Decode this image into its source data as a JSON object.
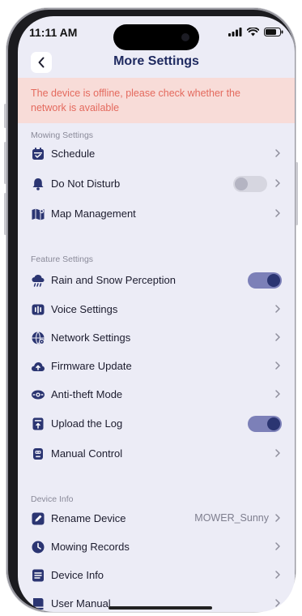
{
  "status_bar": {
    "time": "11:11 AM"
  },
  "header": {
    "title": "More Settings"
  },
  "banner": {
    "text": "The device is offline, please check whether the network is available"
  },
  "colors": {
    "accent": "#2b3572",
    "warning_text": "#e46a5e",
    "warning_bg": "#f8dcd8",
    "screen_bg": "#ececf6"
  },
  "mowing_settings": {
    "label": "Mowing Settings",
    "items": [
      {
        "label": "Schedule",
        "icon": "calendar-icon"
      },
      {
        "label": "Do Not Disturb",
        "icon": "bell-icon",
        "toggle": false
      },
      {
        "label": "Map Management",
        "icon": "map-icon"
      }
    ]
  },
  "feature_settings": {
    "label": "Feature Settings",
    "items": [
      {
        "label": "Rain and Snow Perception",
        "icon": "rain-cloud-icon",
        "toggle": true
      },
      {
        "label": "Voice Settings",
        "icon": "voice-icon"
      },
      {
        "label": "Network Settings",
        "icon": "network-gear-icon"
      },
      {
        "label": "Firmware Update",
        "icon": "cloud-upload-icon"
      },
      {
        "label": "Anti-theft Mode",
        "icon": "anti-theft-icon"
      },
      {
        "label": "Upload the Log",
        "icon": "log-upload-icon",
        "toggle": true
      },
      {
        "label": "Manual Control",
        "icon": "robot-icon"
      }
    ]
  },
  "device_info": {
    "label": "Device Info",
    "items": [
      {
        "label": "Rename Device",
        "icon": "edit-icon",
        "value": "MOWER_Sunny"
      },
      {
        "label": "Mowing Records",
        "icon": "clock-icon"
      },
      {
        "label": "Device Info",
        "icon": "document-icon"
      },
      {
        "label": "User Manual",
        "icon": "book-icon"
      }
    ]
  }
}
